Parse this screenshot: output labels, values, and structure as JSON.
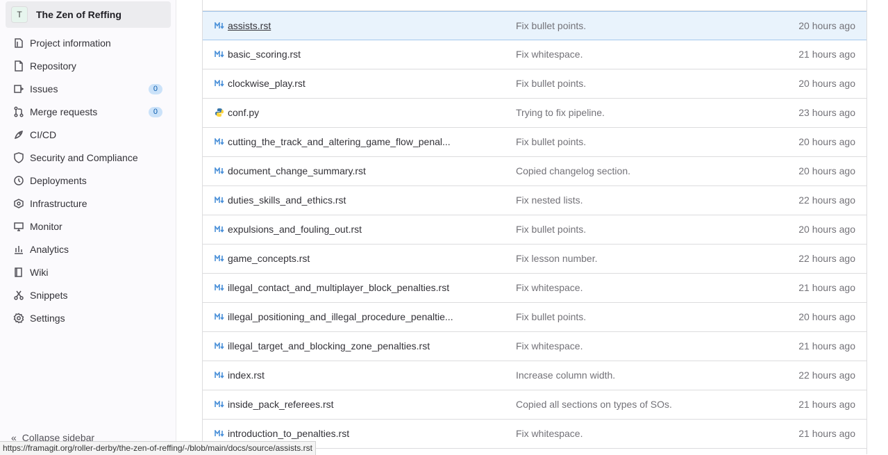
{
  "sidebar": {
    "project_initial": "T",
    "project_name": "The Zen of Reffing",
    "items": [
      {
        "label": "Project information",
        "icon": "project-info-icon"
      },
      {
        "label": "Repository",
        "icon": "repository-icon"
      },
      {
        "label": "Issues",
        "icon": "issues-icon",
        "badge": "0"
      },
      {
        "label": "Merge requests",
        "icon": "merge-request-icon",
        "badge": "0"
      },
      {
        "label": "CI/CD",
        "icon": "rocket-icon"
      },
      {
        "label": "Security and Compliance",
        "icon": "shield-icon"
      },
      {
        "label": "Deployments",
        "icon": "deployments-icon"
      },
      {
        "label": "Infrastructure",
        "icon": "infrastructure-icon"
      },
      {
        "label": "Monitor",
        "icon": "monitor-icon"
      },
      {
        "label": "Analytics",
        "icon": "analytics-icon"
      },
      {
        "label": "Wiki",
        "icon": "book-icon"
      },
      {
        "label": "Snippets",
        "icon": "scissors-icon"
      },
      {
        "label": "Settings",
        "icon": "gear-icon"
      }
    ],
    "collapse_label": "Collapse sidebar"
  },
  "files": [
    {
      "name": "assists.rst",
      "commit": "Fix bullet points.",
      "time": "20 hours ago",
      "type": "markdown"
    },
    {
      "name": "basic_scoring.rst",
      "commit": "Fix whitespace.",
      "time": "21 hours ago",
      "type": "markdown"
    },
    {
      "name": "clockwise_play.rst",
      "commit": "Fix bullet points.",
      "time": "20 hours ago",
      "type": "markdown"
    },
    {
      "name": "conf.py",
      "commit": "Trying to fix pipeline.",
      "time": "23 hours ago",
      "type": "python"
    },
    {
      "name": "cutting_the_track_and_altering_game_flow_penal...",
      "commit": "Fix bullet points.",
      "time": "20 hours ago",
      "type": "markdown"
    },
    {
      "name": "document_change_summary.rst",
      "commit": "Copied changelog section.",
      "time": "20 hours ago",
      "type": "markdown"
    },
    {
      "name": "duties_skills_and_ethics.rst",
      "commit": "Fix nested lists.",
      "time": "22 hours ago",
      "type": "markdown"
    },
    {
      "name": "expulsions_and_fouling_out.rst",
      "commit": "Fix bullet points.",
      "time": "20 hours ago",
      "type": "markdown"
    },
    {
      "name": "game_concepts.rst",
      "commit": "Fix lesson number.",
      "time": "22 hours ago",
      "type": "markdown"
    },
    {
      "name": "illegal_contact_and_multiplayer_block_penalties.rst",
      "commit": "Fix whitespace.",
      "time": "21 hours ago",
      "type": "markdown"
    },
    {
      "name": "illegal_positioning_and_illegal_procedure_penaltie...",
      "commit": "Fix bullet points.",
      "time": "20 hours ago",
      "type": "markdown"
    },
    {
      "name": "illegal_target_and_blocking_zone_penalties.rst",
      "commit": "Fix whitespace.",
      "time": "21 hours ago",
      "type": "markdown"
    },
    {
      "name": "index.rst",
      "commit": "Increase column width.",
      "time": "22 hours ago",
      "type": "markdown"
    },
    {
      "name": "inside_pack_referees.rst",
      "commit": "Copied all sections on types of SOs.",
      "time": "21 hours ago",
      "type": "markdown"
    },
    {
      "name": "introduction_to_penalties.rst",
      "commit": "Fix whitespace.",
      "time": "21 hours ago",
      "type": "markdown"
    }
  ],
  "status_url": "https://framagit.org/roller-derby/the-zen-of-reffing/-/blob/main/docs/source/assists.rst",
  "colors": {
    "markdown_icon": "#4a90d9",
    "badge_bg": "#cbe2f9",
    "highlight_row": "#e9f3fc"
  }
}
